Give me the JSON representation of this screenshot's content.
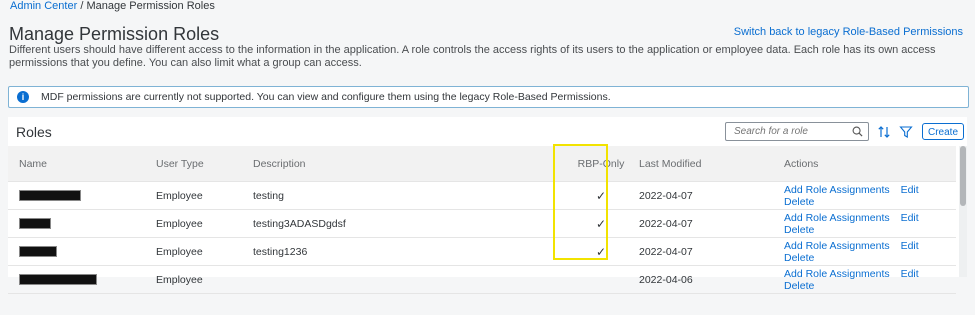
{
  "breadcrumb": {
    "parent": "Admin Center",
    "separator": "/",
    "current": "Manage Permission Roles"
  },
  "page": {
    "title": "Manage Permission Roles",
    "legacy_link": "Switch back to legacy Role-Based Permissions",
    "description": "Different users should have different access to the information in the application. A role controls the access rights of its users to the application or employee data. Each role has its own access permissions that you define. You can also limit what a group can access."
  },
  "banner": {
    "icon": "info-icon",
    "text": "MDF permissions are currently not supported. You can view and configure them using the legacy Role-Based Permissions."
  },
  "roles": {
    "title": "Roles",
    "search_placeholder": "Search for a role",
    "create_label": "Create",
    "columns": [
      "Name",
      "User Type",
      "Description",
      "RBP-Only",
      "Last Modified",
      "Actions"
    ],
    "rows": [
      {
        "user_type": "Employee",
        "description": "testing",
        "rbp_only": "✓",
        "last_modified": "2022-04-07",
        "actions": [
          "Add Role Assignments",
          "Edit",
          "Delete"
        ]
      },
      {
        "user_type": "Employee",
        "description": "testing3ADASDgdsf",
        "rbp_only": "✓",
        "last_modified": "2022-04-07",
        "actions": [
          "Add Role Assignments",
          "Edit",
          "Delete"
        ]
      },
      {
        "user_type": "Employee",
        "description": "testing1236",
        "rbp_only": "✓",
        "last_modified": "2022-04-07",
        "actions": [
          "Add Role Assignments",
          "Edit",
          "Delete"
        ]
      },
      {
        "user_type": "Employee",
        "description": "",
        "rbp_only": "",
        "last_modified": "2022-04-06",
        "actions": [
          "Add Role Assignments",
          "Edit",
          "Delete"
        ]
      }
    ]
  },
  "colors": {
    "link": "#0a6ed1",
    "highlight": "#f2e300",
    "banner_border": "#7fb3d5"
  }
}
